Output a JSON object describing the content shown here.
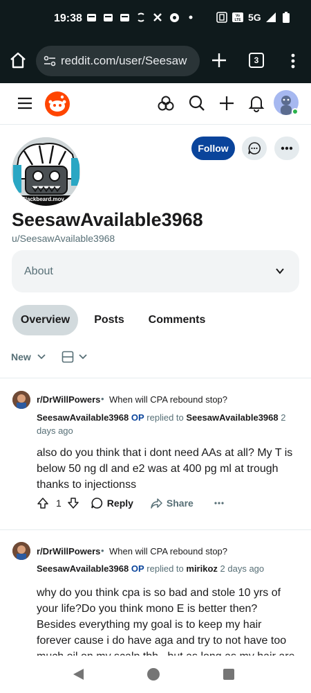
{
  "status": {
    "time": "19:38",
    "network": "5G",
    "volte": "Vo LTE"
  },
  "browser": {
    "url": "reddit.com/user/Seesaw",
    "tab_count": "3"
  },
  "profile": {
    "avatar_caption": "Blackbeard.mov",
    "username": "SeesawAvailable3968",
    "handle": "u/SeesawAvailable3968",
    "follow_label": "Follow",
    "about_label": "About"
  },
  "tabs": [
    {
      "label": "Overview",
      "active": true
    },
    {
      "label": "Posts",
      "active": false
    },
    {
      "label": "Comments",
      "active": false
    }
  ],
  "sort": {
    "label": "New"
  },
  "comments": [
    {
      "subreddit": "r/DrWillPowers",
      "post_title": "When will CPA rebound stop?",
      "author": "SeesawAvailable3968",
      "op_tag": "OP",
      "replied_to_text": "replied to",
      "replied_to": "SeesawAvailable3968",
      "time": "2 days ago",
      "body": "also do you think that i dont need AAs at all? My T is below 50 ng dl and e2 was at 400 pg ml at trough thanks to injectionss",
      "score": "1",
      "reply_label": "Reply",
      "share_label": "Share"
    },
    {
      "subreddit": "r/DrWillPowers",
      "post_title": "When will CPA rebound stop?",
      "author": "SeesawAvailable3968",
      "op_tag": "OP",
      "replied_to_text": "replied to",
      "replied_to": "mirikoz",
      "time": "2 days ago",
      "body": "why do you think cpa is so bad and stole 10 yrs of your life?Do you think mono E is better then? Besides everything my goal is to keep my hair forever cause i do have aga and try to not have too much oil on my scalp tbh , but as long as my hair are thick and healthy i dont"
    }
  ],
  "colors": {
    "follow_button": "#0a449b",
    "reddit_orange": "#ff4500",
    "op_tag": "#0a449b",
    "online_dot": "#2bb24c"
  }
}
